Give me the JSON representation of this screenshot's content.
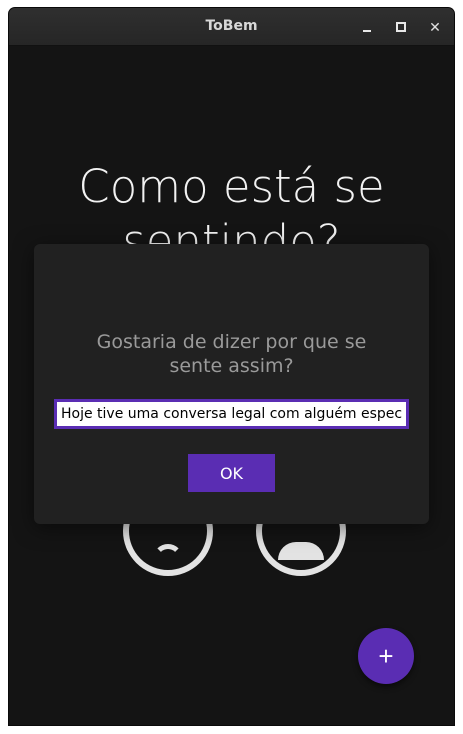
{
  "window": {
    "title": "ToBem",
    "controls": {
      "minimize_icon": "minimize-icon",
      "maximize_icon": "maximize-icon",
      "close_label": "✕"
    }
  },
  "main": {
    "heading": "Como está se sentindo?",
    "moods": [
      {
        "name": "sad-face-icon"
      },
      {
        "name": "neutral-face-icon"
      }
    ],
    "fab_label": "+"
  },
  "dialog": {
    "question": "Gostaria de dizer por que se sente assim?",
    "input_value": "Hoje tive uma conversa legal com alguém especial",
    "ok_label": "OK"
  },
  "colors": {
    "accent": "#5a2db3",
    "background": "#141414",
    "dialog_background": "#212121",
    "text_muted": "#9a9a9a"
  }
}
